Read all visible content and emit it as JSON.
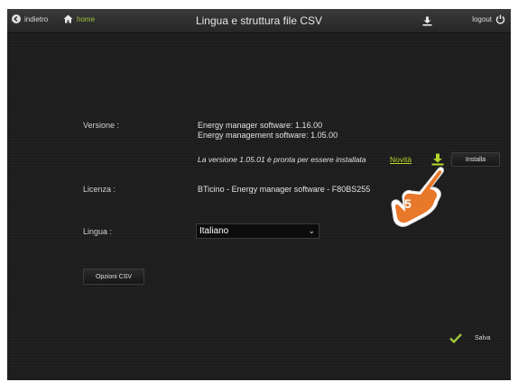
{
  "header": {
    "back_label": "indietro",
    "home_label": "home",
    "title": "Lingua e struttura file CSV",
    "logout_label": "logout"
  },
  "versione": {
    "label": "Versione :",
    "line1": "Energy manager software: 1.16.00",
    "line2": "Energy management software: 1.05.00",
    "notice": "La versione 1.05.01 è pronta per essere installata",
    "novita": "Novità",
    "install_label": "Installa"
  },
  "licenza": {
    "label": "Licenza :",
    "value": "BTicino - Energy manager software - F80BS255"
  },
  "lingua": {
    "label": "Lingua :",
    "selected": "Italiano"
  },
  "csv_button_label": "Opzioni CSV",
  "save_label": "Salva",
  "callout_number": "5",
  "colors": {
    "accent_green": "#9fc33b",
    "callout_orange": "#e8782a"
  }
}
